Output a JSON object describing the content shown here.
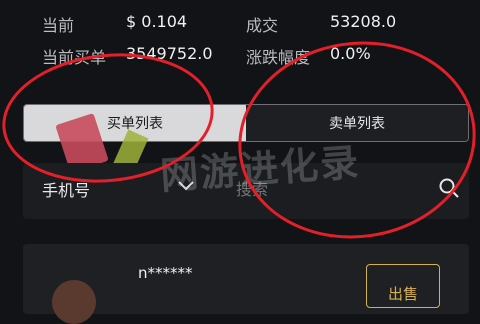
{
  "stats": {
    "current_label": "当前",
    "current_value": "$ 0.104",
    "deal_label": "成交",
    "deal_value": "53208.0",
    "buy_order_label": "当前买单",
    "buy_order_value": "3549752.0",
    "change_label": "涨跌幅度",
    "change_value": "0.0%"
  },
  "tabs": [
    {
      "label": "买单列表",
      "active": true
    },
    {
      "label": "卖单列表",
      "active": false
    }
  ],
  "search": {
    "filter_label": "手机号",
    "placeholder": "搜索"
  },
  "list": [
    {
      "user": "n******",
      "action": "出售"
    }
  ],
  "watermark": "网游进化录",
  "colors": {
    "accent_gold": "#d6b14a",
    "annotation_red": "#e3202a",
    "background": "#121316"
  }
}
